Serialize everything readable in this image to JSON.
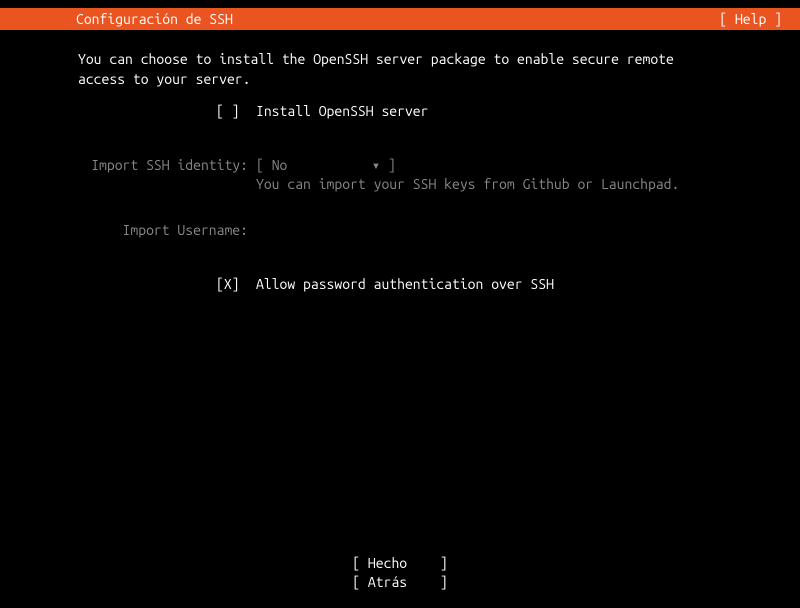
{
  "header": {
    "title": "Configuración de SSH",
    "help_label": "[ Help ]"
  },
  "intro": "You can choose to install the OpenSSH server package to enable secure remote access to your server.",
  "install_checkbox": {
    "box": "[ ]",
    "label": "Install OpenSSH server"
  },
  "import_identity": {
    "label": "Import SSH identity:",
    "bracket_open": "[ ",
    "value": "No",
    "arrow": "▾",
    "bracket_close": " ]",
    "hint": "You can import your SSH keys from Github or Launchpad."
  },
  "import_username": {
    "label": "Import Username:",
    "value": ""
  },
  "allow_password": {
    "box": "[X]",
    "label": "Allow password authentication over SSH"
  },
  "footer": {
    "done": {
      "open": "[ ",
      "text": "Hecho",
      "close": "]"
    },
    "back": {
      "open": "[ ",
      "text": "Atrás",
      "close": "]"
    }
  }
}
